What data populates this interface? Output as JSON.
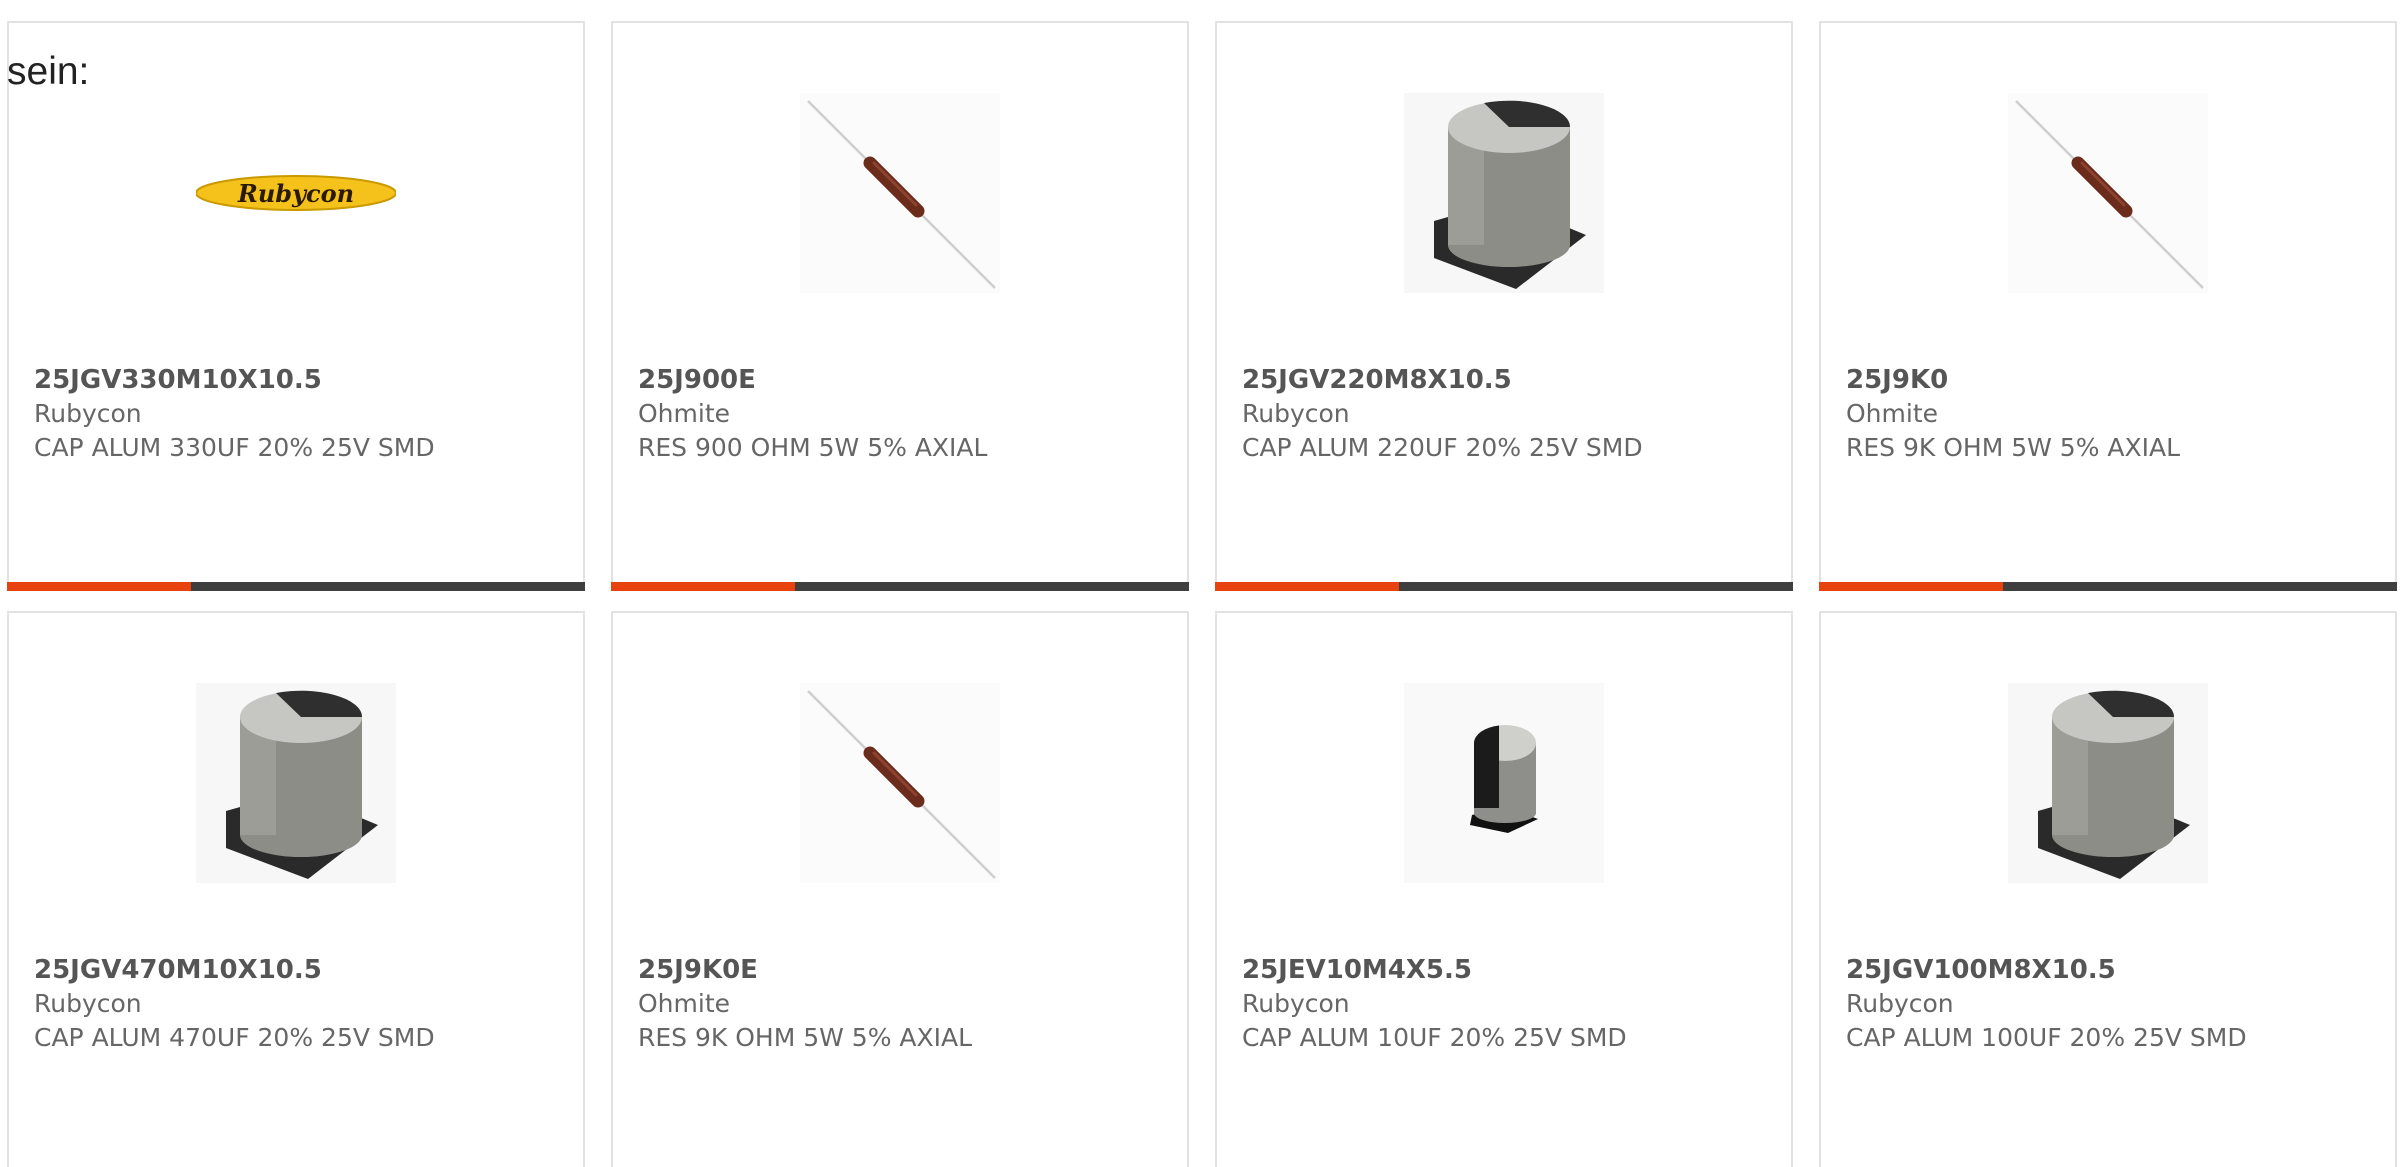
{
  "lead_text": "sein:",
  "accent_color": "#e8430e",
  "cards": [
    {
      "part": "25JGV330M10X10.5",
      "manufacturer": "Rubycon",
      "description": "CAP ALUM 330UF 20% 25V SMD",
      "image": "rubycon-logo",
      "logo_text": "Rubycon"
    },
    {
      "part": "25J900E",
      "manufacturer": "Ohmite",
      "description": "RES 900 OHM 5W 5% AXIAL",
      "image": "axial-resistor-icon"
    },
    {
      "part": "25JGV220M8X10.5",
      "manufacturer": "Rubycon",
      "description": "CAP ALUM 220UF 20% 25V SMD",
      "image": "smd-capacitor-icon"
    },
    {
      "part": "25J9K0",
      "manufacturer": "Ohmite",
      "description": "RES 9K OHM 5W 5% AXIAL",
      "image": "axial-resistor-icon"
    },
    {
      "part": "25JGV470M10X10.5",
      "manufacturer": "Rubycon",
      "description": "CAP ALUM 470UF 20% 25V SMD",
      "image": "smd-capacitor-icon"
    },
    {
      "part": "25J9K0E",
      "manufacturer": "Ohmite",
      "description": "RES 9K OHM 5W 5% AXIAL",
      "image": "axial-resistor-icon"
    },
    {
      "part": "25JEV10M4X5.5",
      "manufacturer": "Rubycon",
      "description": "CAP ALUM 10UF 20% 25V SMD",
      "image": "small-smd-capacitor-icon"
    },
    {
      "part": "25JGV100M8X10.5",
      "manufacturer": "Rubycon",
      "description": "CAP ALUM 100UF 20% 25V SMD",
      "image": "smd-capacitor-icon"
    }
  ]
}
